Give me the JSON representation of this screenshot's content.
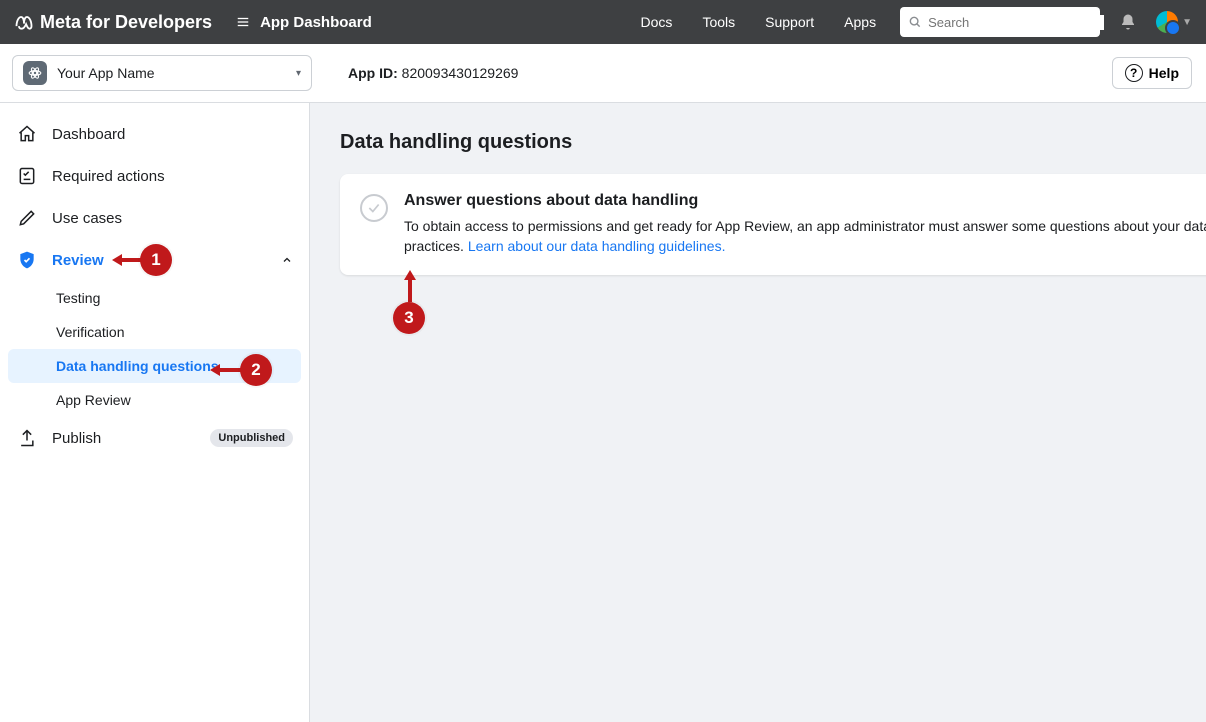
{
  "topbar": {
    "brand_text": "Meta for Developers",
    "dashboard_label": "App Dashboard",
    "nav": [
      "Docs",
      "Tools",
      "Support",
      "Apps"
    ],
    "search_placeholder": "Search"
  },
  "subheader": {
    "app_name": "Your App Name",
    "app_id_label": "App ID:",
    "app_id_value": "820093430129269",
    "help_label": "Help"
  },
  "sidebar": {
    "items": [
      {
        "label": "Dashboard"
      },
      {
        "label": "Required actions"
      },
      {
        "label": "Use cases"
      },
      {
        "label": "Review"
      },
      {
        "label": "Publish",
        "pill": "Unpublished"
      }
    ],
    "review_sub": [
      {
        "label": "Testing"
      },
      {
        "label": "Verification"
      },
      {
        "label": "Data handling questions"
      },
      {
        "label": "App Review"
      }
    ]
  },
  "main": {
    "page_title": "Data handling questions",
    "card_title": "Answer questions about data handling",
    "card_text": "To obtain access to permissions and get ready for App Review, an app administrator must answer some questions about your data handling practices.",
    "card_link": "Learn about our data handling guidelines."
  },
  "annotations": {
    "m1": "1",
    "m2": "2",
    "m3": "3"
  }
}
